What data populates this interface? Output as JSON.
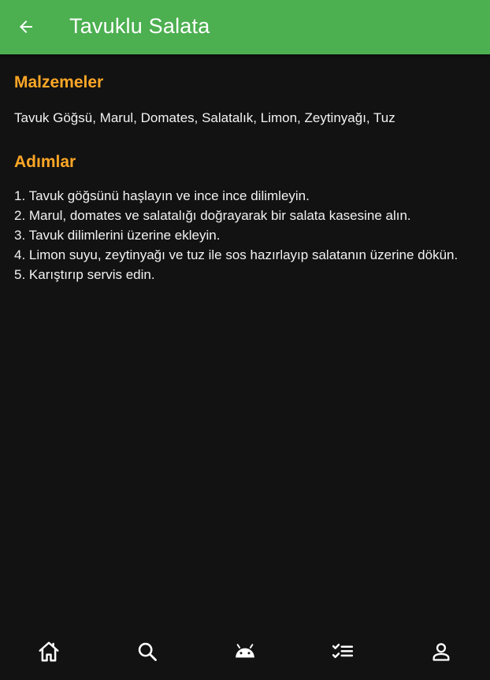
{
  "appbar": {
    "back_icon": "arrow-left-icon",
    "title": "Tavuklu Salata"
  },
  "ingredients": {
    "title": "Malzemeler",
    "text": "Tavuk Göğsü, Marul, Domates, Salatalık, Limon, Zeytinyağı, Tuz"
  },
  "steps": {
    "title": "Adımlar",
    "items": [
      "1. Tavuk göğsünü haşlayın ve ince ince dilimleyin.",
      "2. Marul, domates ve salatalığı doğrayarak bir salata kasesine alın.",
      "3. Tavuk dilimlerini üzerine ekleyin.",
      "4. Limon suyu, zeytinyağı ve tuz ile sos hazırlayıp salatanın üzerine dökün.",
      "5. Karıştırıp servis edin."
    ]
  },
  "bottom_nav": {
    "items": [
      {
        "icon": "home-icon"
      },
      {
        "icon": "search-icon"
      },
      {
        "icon": "android-icon"
      },
      {
        "icon": "checklist-icon"
      },
      {
        "icon": "person-icon"
      }
    ]
  },
  "colors": {
    "appbar": "#4CAF50",
    "background": "#121212",
    "section_title": "#FFA726",
    "text": "#F2F2F2",
    "icon": "#FFFFFF"
  }
}
